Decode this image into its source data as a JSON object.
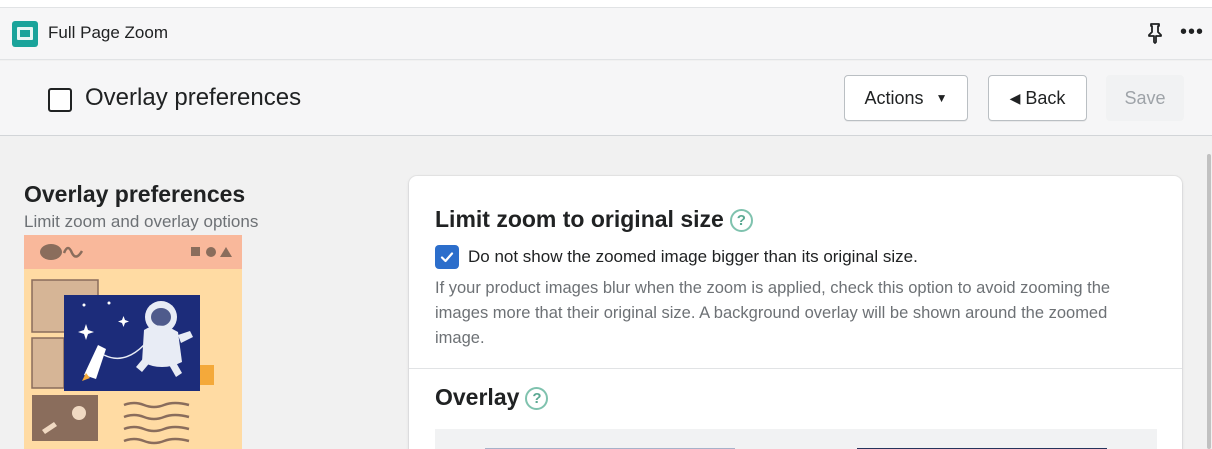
{
  "app": {
    "title": "Full Page Zoom",
    "logo_icon": "app-logo-icon",
    "pin_icon": "pin-icon",
    "more_label": "•••"
  },
  "header": {
    "title": "Overlay preferences",
    "actions_label": "Actions",
    "back_label": "Back",
    "save_label": "Save"
  },
  "section": {
    "title": "Overlay preferences",
    "subtitle": "Limit zoom and overlay options"
  },
  "card": {
    "limit_title": "Limit zoom to original size",
    "help_glyph": "?",
    "checkbox_label": "Do not show the zoomed image bigger than its original size.",
    "checkbox_checked": true,
    "help_text": "If your product images blur when the zoom is applied, check this option to avoid zooming the images more that their original size. A background overlay will be shown around the zoomed image.",
    "overlay_title": "Overlay"
  },
  "colors": {
    "accent_blue": "#2c6ecb",
    "help_green": "#5aa892",
    "app_teal": "#1aa39a"
  }
}
